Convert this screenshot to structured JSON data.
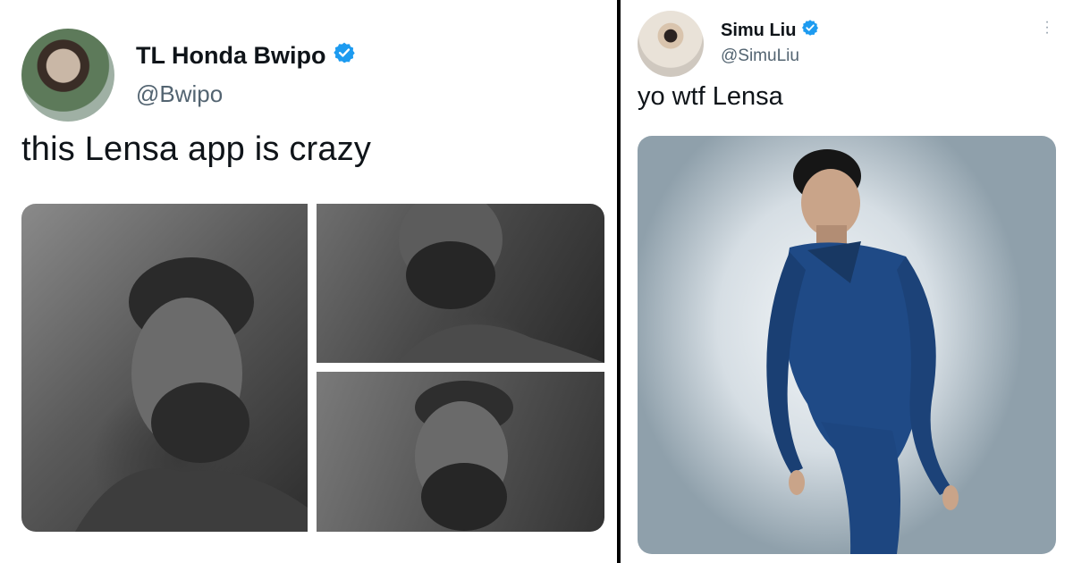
{
  "left_tweet": {
    "display_name": "TL Honda Bwipo",
    "handle": "@Bwipo",
    "text": "this Lensa app is crazy",
    "verified": true,
    "images": [
      {
        "description_name": "large-portrait-photo"
      },
      {
        "description_name": "top-right-portrait-photo"
      },
      {
        "description_name": "bottom-right-portrait-photo"
      }
    ]
  },
  "right_tweet": {
    "display_name": "Simu Liu",
    "handle": "@SimuLiu",
    "text": "yo wtf Lensa",
    "verified": true
  },
  "colors": {
    "verified_blue": "#1d9bf0",
    "handle_gray": "#536471",
    "divider": "#000000",
    "suit_blue": "#1f4a86"
  },
  "icons": {
    "verified": "verified-badge-icon",
    "more": "more-options-icon"
  }
}
